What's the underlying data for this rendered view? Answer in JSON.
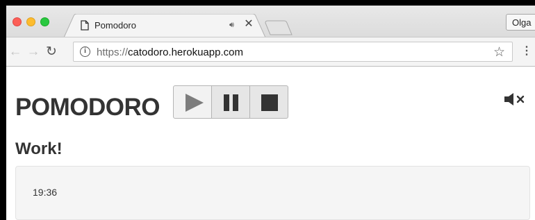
{
  "browser": {
    "tab": {
      "title": "Pomodoro",
      "favicon": "page-icon",
      "audio_icon": "audio-playing-icon",
      "close_icon": "close-icon"
    },
    "profile_label": "Olga",
    "toolbar": {
      "back_icon": "back-arrow-icon",
      "forward_icon": "forward-arrow-icon",
      "reload_icon": "reload-icon",
      "security_icon": "info-icon",
      "url_scheme": "https://",
      "url_host": "catodoro.herokuapp.com",
      "bookmark_icon": "star-icon",
      "menu_icon": "kebab-menu-icon"
    }
  },
  "app": {
    "title": "POMODORO",
    "controls": [
      {
        "name": "play",
        "icon": "play-icon"
      },
      {
        "name": "pause",
        "icon": "pause-icon"
      },
      {
        "name": "stop",
        "icon": "stop-icon"
      }
    ],
    "mute_icon": "speaker-muted-icon",
    "mode_heading": "Work!",
    "timer": "19:36"
  },
  "colors": {
    "text": "#333333",
    "well_background": "#f5f5f5",
    "traffic_red": "#fc5f57",
    "traffic_yellow": "#fdbc2e",
    "traffic_green": "#29c840"
  }
}
